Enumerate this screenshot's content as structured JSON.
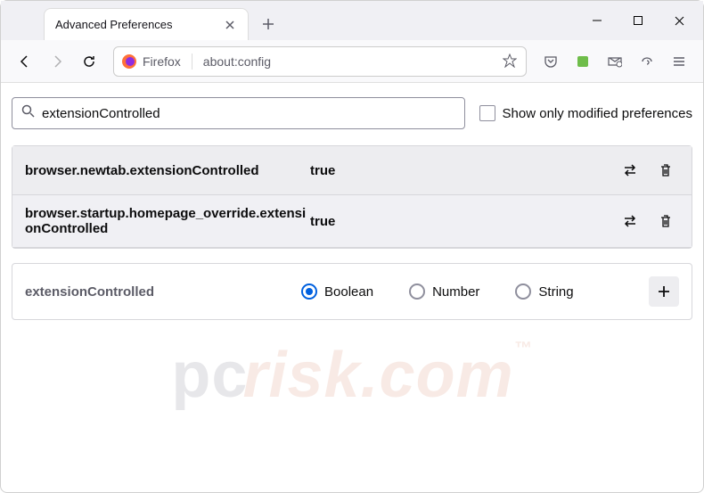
{
  "tab": {
    "title": "Advanced Preferences"
  },
  "urlbar": {
    "identity": "Firefox",
    "url": "about:config"
  },
  "search": {
    "value": "extensionControlled",
    "show_modified_label": "Show only modified preferences"
  },
  "prefs": [
    {
      "name": "browser.newtab.extensionControlled",
      "value": "true"
    },
    {
      "name": "browser.startup.homepage_override.extensionControlled",
      "value": "true"
    }
  ],
  "new_pref": {
    "name": "extensionControlled",
    "types": {
      "boolean": "Boolean",
      "number": "Number",
      "string": "String"
    },
    "selected": "boolean"
  },
  "watermark": "pcrisk.com"
}
